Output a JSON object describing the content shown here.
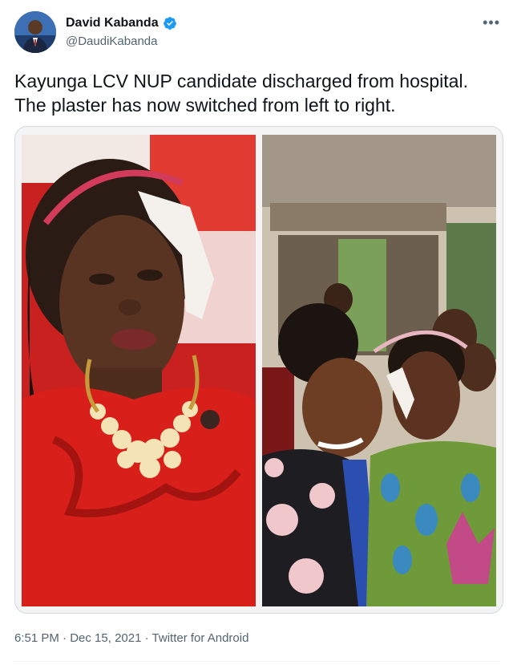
{
  "author": {
    "name": "David Kabanda",
    "handle": "@DaudiKabanda",
    "verified": true
  },
  "tweet": {
    "text_line1": "Kayunga LCV NUP candidate discharged from hospital.",
    "text_line2": "The plaster has now switched from left to right."
  },
  "media": {
    "count": 2,
    "icons": [
      "photo-left",
      "photo-right"
    ]
  },
  "meta": {
    "time": "6:51 PM",
    "sep1": " · ",
    "date": "Dec 15, 2021",
    "sep2": " · ",
    "source": "Twitter for Android"
  },
  "colors": {
    "accent": "#1d9bf0",
    "text": "#0f1419",
    "secondary": "#536471",
    "border": "#cfd9de"
  },
  "more_icon": "more-horizontal-icon"
}
